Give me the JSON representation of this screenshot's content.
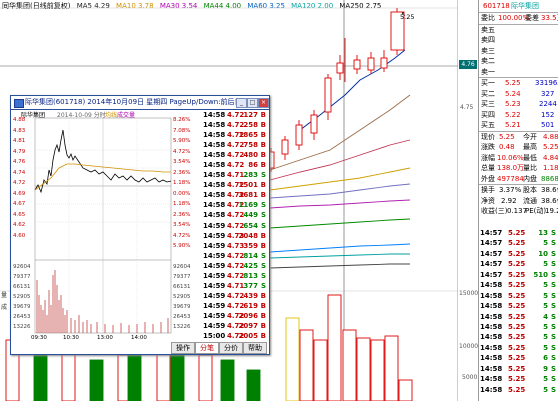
{
  "chart_header": {
    "name": "同华集团(日线前复权)",
    "ma5": "MA5 4.29",
    "ma10": "MA10 3.78",
    "ma30": "MA30 3.54",
    "ma44": "MA44 4.00",
    "ma60": "MA60 3.25",
    "ma120": "MA120 2.00",
    "ma250": "MA250 2.75"
  },
  "price_labels": {
    "high_marker": "5.25",
    "current_price_tag": "4.76"
  },
  "left_axis_labels": [
    "量",
    "成"
  ],
  "right_axis": {
    "price_ticks": [
      "4.75"
    ],
    "volume_ticks": [
      "15000",
      "10000",
      "5000"
    ]
  },
  "quote_panel": {
    "code": "601718",
    "name": "际华集团",
    "weibi_label": "委比",
    "weibi_value": "100.00%",
    "weicha_label": "委差",
    "weicha_value": "33.5万",
    "sell_levels": [
      {
        "label": "卖五",
        "price": "",
        "vol": ""
      },
      {
        "label": "卖四",
        "price": "",
        "vol": ""
      },
      {
        "label": "卖三",
        "price": "",
        "vol": ""
      },
      {
        "label": "卖二",
        "price": "",
        "vol": ""
      },
      {
        "label": "卖一",
        "price": "",
        "vol": ""
      }
    ],
    "buy_levels": [
      {
        "label": "买一",
        "price": "5.25",
        "vol": "331963"
      },
      {
        "label": "买二",
        "price": "5.24",
        "vol": "327"
      },
      {
        "label": "买三",
        "price": "5.23",
        "vol": "2244"
      },
      {
        "label": "买四",
        "price": "5.22",
        "vol": "152"
      },
      {
        "label": "买五",
        "price": "5.21",
        "vol": "501"
      }
    ],
    "stats": [
      {
        "l1": "现价",
        "v1": "5.25",
        "l2": "今开",
        "v2": "4.88"
      },
      {
        "l1": "涨跌",
        "v1": "0.48",
        "l2": "最高",
        "v2": "5.25"
      },
      {
        "l1": "涨幅",
        "v1": "10.06%",
        "l2": "最低",
        "v2": "4.84"
      },
      {
        "l1": "总量",
        "v1": "138.0万",
        "l2": "量比",
        "v2": "1.18"
      },
      {
        "l1": "外盘",
        "v1": "497784",
        "l2": "内盘",
        "v2": "886865"
      }
    ],
    "stats2": [
      {
        "l1": "换手",
        "v1": "3.37%",
        "l2": "股本",
        "v2": "38.6亿"
      },
      {
        "l1": "净资",
        "v1": "2.92",
        "l2": "流通",
        "v2": "38.6亿"
      },
      {
        "l1": "收益(三)",
        "v1": "0.137",
        "l2": "PE(动)",
        "v2": "19.2"
      }
    ],
    "ticks": [
      {
        "time": "14:57",
        "price": "5.25",
        "vol": "13",
        "dir": "S"
      },
      {
        "time": "14:57",
        "price": "5.25",
        "vol": "5",
        "dir": "S"
      },
      {
        "time": "14:57",
        "price": "5.25",
        "vol": "10",
        "dir": "S"
      },
      {
        "time": "14:57",
        "price": "5.25",
        "vol": "5",
        "dir": "S"
      },
      {
        "time": "14:57",
        "price": "5.25",
        "vol": "510",
        "dir": "S"
      },
      {
        "time": "14:58",
        "price": "5.25",
        "vol": "5",
        "dir": "S"
      },
      {
        "time": "14:58",
        "price": "5.25",
        "vol": "5",
        "dir": "S"
      },
      {
        "time": "14:58",
        "price": "5.25",
        "vol": "5",
        "dir": "S"
      },
      {
        "time": "14:58",
        "price": "5.25",
        "vol": "4",
        "dir": "S"
      },
      {
        "time": "14:58",
        "price": "5.25",
        "vol": "5",
        "dir": "S"
      },
      {
        "time": "14:58",
        "price": "5.25",
        "vol": "5",
        "dir": "S"
      },
      {
        "time": "14:58",
        "price": "5.25",
        "vol": "5",
        "dir": "S"
      },
      {
        "time": "14:58",
        "price": "5.25",
        "vol": "6",
        "dir": "S"
      },
      {
        "time": "14:58",
        "price": "5.25",
        "vol": "9",
        "dir": "S"
      },
      {
        "time": "14:58",
        "price": "5.25",
        "vol": "5",
        "dir": "S"
      },
      {
        "time": "14:58",
        "price": "5.25",
        "vol": "5",
        "dir": "S"
      }
    ]
  },
  "popup": {
    "title": "际华集团(601718)  2014年10月09日  星期四  PageUp/Down:前后日  空格键:操作",
    "chart_title": "际华集团",
    "chart_date": "2014-10-09 分时",
    "chart_legend_a": "均线",
    "chart_legend_b": "成交量",
    "price_ticks_left": [
      "4.88",
      "4.83",
      "4.81",
      "4.79",
      "4.76",
      "4.74",
      "4.72",
      "4.69",
      "4.67",
      "4.65",
      "4.62",
      "4.60"
    ],
    "pct_ticks_right": [
      "8.26%",
      "7.08%",
      "5.90%",
      "4.72%",
      "3.54%",
      "2.36%",
      "1.18%",
      "0.00%",
      "1.18%",
      "2.36%",
      "3.54%",
      "4.72%",
      "5.90%"
    ],
    "vol_ticks_left": [
      "92604",
      "79377",
      "66131",
      "52905",
      "39679",
      "26453",
      "13226"
    ],
    "vol_ticks_right": [
      "92604",
      "79377",
      "66131",
      "52905",
      "39679",
      "26453",
      "13226"
    ],
    "time_ticks": [
      "09:30",
      "10:30",
      "13:00",
      "14:00"
    ],
    "ticks": [
      {
        "time": "14:58",
        "price": "4.72",
        "vol": "127",
        "dir": "B"
      },
      {
        "time": "14:58",
        "price": "4.72",
        "vol": "258",
        "dir": "B"
      },
      {
        "time": "14:58",
        "price": "4.72",
        "vol": "1865",
        "dir": "B"
      },
      {
        "time": "14:58",
        "price": "4.72",
        "vol": "758",
        "dir": "B"
      },
      {
        "time": "14:58",
        "price": "4.72",
        "vol": "480",
        "dir": "B"
      },
      {
        "time": "14:58",
        "price": "4.72",
        "vol": "86",
        "dir": "B"
      },
      {
        "time": "14:58",
        "price": "4.71",
        "vol": "283",
        "dir": "S"
      },
      {
        "time": "14:58",
        "price": "4.72",
        "vol": "1501",
        "dir": "B"
      },
      {
        "time": "14:58",
        "price": "4.72",
        "vol": "3681",
        "dir": "B"
      },
      {
        "time": "14:58",
        "price": "4.72",
        "vol": "1169",
        "dir": "S"
      },
      {
        "time": "14:58",
        "price": "4.72",
        "vol": "449",
        "dir": "S"
      },
      {
        "time": "14:59",
        "price": "4.72",
        "vol": "654",
        "dir": "S"
      },
      {
        "time": "14:59",
        "price": "4.73",
        "vol": "2048",
        "dir": "B"
      },
      {
        "time": "14:59",
        "price": "4.73",
        "vol": "359",
        "dir": "B"
      },
      {
        "time": "14:59",
        "price": "4.72",
        "vol": "814",
        "dir": "S"
      },
      {
        "time": "14:59",
        "price": "4.72",
        "vol": "425",
        "dir": "S"
      },
      {
        "time": "14:59",
        "price": "4.72",
        "vol": "813",
        "dir": "S"
      },
      {
        "time": "14:59",
        "price": "4.71",
        "vol": "377",
        "dir": "S"
      },
      {
        "time": "14:59",
        "price": "4.72",
        "vol": "439",
        "dir": "B"
      },
      {
        "time": "14:59",
        "price": "4.72",
        "vol": "619",
        "dir": "B"
      },
      {
        "time": "14:59",
        "price": "4.72",
        "vol": "2096",
        "dir": "B"
      },
      {
        "time": "14:59",
        "price": "4.72",
        "vol": "2097",
        "dir": "B"
      },
      {
        "time": "15:00",
        "price": "4.72",
        "vol": "2005",
        "dir": "B"
      }
    ],
    "tabs": [
      "操作",
      "分笔",
      "分价",
      "帮助"
    ]
  }
}
